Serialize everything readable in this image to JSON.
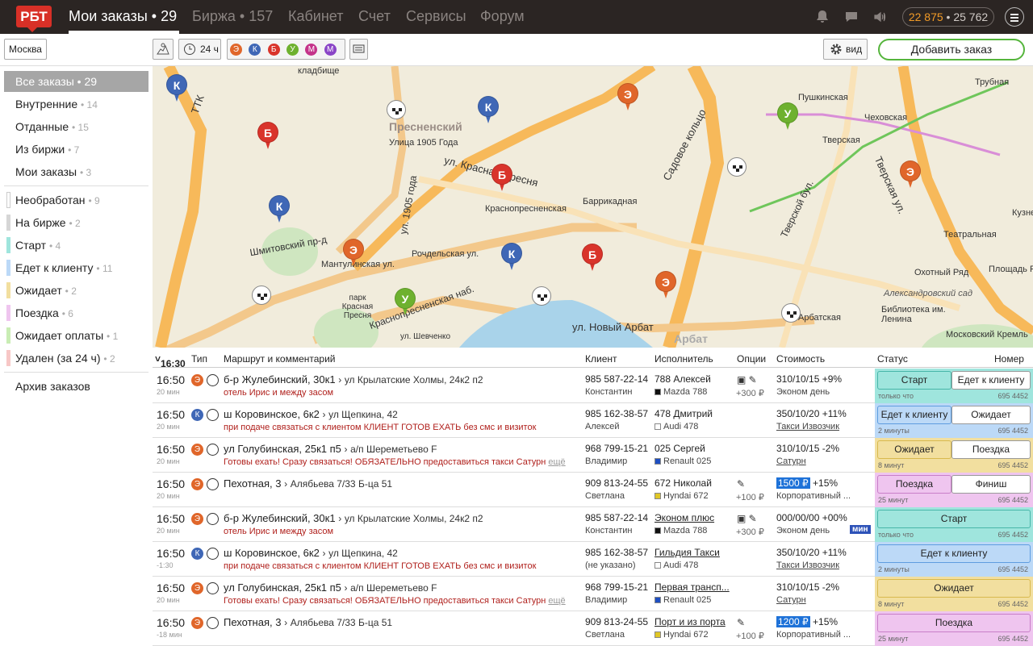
{
  "app": {
    "logo": "РБТ"
  },
  "topnav": [
    {
      "label": "Мои заказы • 29",
      "active": true
    },
    {
      "label": "Биржа • 157"
    },
    {
      "label": "Кабинет"
    },
    {
      "label": "Счет"
    },
    {
      "label": "Сервисы"
    },
    {
      "label": "Форум"
    }
  ],
  "balance": {
    "primary": "22 875",
    "separator": " • ",
    "secondary": "25 762"
  },
  "toolbar": {
    "city": "Москва",
    "period": "24 ч",
    "type_letters": [
      "Э",
      "К",
      "Б",
      "У",
      "М",
      "М"
    ],
    "view_label": "вид",
    "add_order": "Добавить заказ"
  },
  "sidebar": {
    "group1": [
      {
        "label": "Все заказы • 29",
        "count": ""
      },
      {
        "label": "Внутренние",
        "count": "• 14"
      },
      {
        "label": "Отданные",
        "count": "• 15"
      },
      {
        "label": "Из биржи",
        "count": "• 7"
      },
      {
        "label": "Мои заказы",
        "count": "• 3"
      }
    ],
    "group2": [
      {
        "label": "Необработан",
        "count": "• 9",
        "color": "#ffffff"
      },
      {
        "label": "На бирже",
        "count": "• 2",
        "color": "#d6d6d6"
      },
      {
        "label": "Старт",
        "count": "• 4",
        "color": "#9fe5dd"
      },
      {
        "label": "Едет к клиенту",
        "count": "• 11",
        "color": "#bcd9f7"
      },
      {
        "label": "Ожидает",
        "count": "• 2",
        "color": "#f2df9f"
      },
      {
        "label": "Поездка",
        "count": "• 6",
        "color": "#efc5ef"
      },
      {
        "label": "Ожидает оплаты",
        "count": "• 1",
        "color": "#c9edb4"
      },
      {
        "label": "Удален (за 24 ч)",
        "count": "• 2",
        "color": "#f7c7c6"
      }
    ],
    "archive": "Архив заказов"
  },
  "map": {
    "labels": [
      "кладбище",
      "Трубная",
      "Пушкинская",
      "Чеховская",
      "Тверская",
      "Пресненский",
      "Улица 1905 Года",
      "ул. Красная Пресня",
      "Баррикадная",
      "Краснопресненская",
      "Садовое кольцо",
      "Тверской бул.",
      "Тверская ул.",
      "Кузнец",
      "Театральная",
      "Охотный Ряд",
      "Площадь Революции",
      "Александровский сад",
      "Библиотека им. Ленина",
      "Московский Кремль",
      "Арбатская",
      "ул. Новый Арбат",
      "Арбат",
      "Шмитовский пр-д",
      "Мантулинская ул.",
      "Рочдельская ул.",
      "Краснопресненская наб.",
      "парк Красная Пресня",
      "ТТК",
      "ул. 1905 года",
      "ул. Шевченко"
    ]
  },
  "table": {
    "header": {
      "time": "16:30",
      "type": "Тип",
      "route": "Маршрут и комментарий",
      "client": "Клиент",
      "executor": "Исполнитель",
      "options": "Опции",
      "cost": "Стоимость",
      "status": "Статус",
      "number": "Номер"
    },
    "rows": [
      {
        "time": "16:50",
        "ago": "20 мин",
        "type": "Э",
        "from": "б-р Жулебинский, 30к1",
        "to": "ул Крылатские Холмы, 24к2 п2",
        "comment": "отель Ирис и между засом",
        "more": "",
        "phone": "985 587-22-14",
        "client": "Константин",
        "executor": "788 Алексей",
        "car": "Mazda 788",
        "carcolor": "#111111",
        "options": "+300 ₽",
        "price_box": "",
        "price": "310/10/15 +9%",
        "tariff": "Эконом день",
        "status_a": "Старт",
        "status_b": "Едет к клиенту",
        "since": "только что",
        "number": "695 4452",
        "bg": "#9fe5dd",
        "border": "#48b6a9"
      },
      {
        "time": "16:50",
        "ago": "20 мин",
        "type": "К",
        "from": "ш Коровинское, 6к2",
        "to": "ул Щепкина, 42",
        "comment": "при подаче связаться с клиентом КЛИЕНТ ГОТОВ ЕХАТЬ без смс и визиток",
        "more": "",
        "phone": "985 162-38-57",
        "client": "Алексей",
        "executor": "478 Дмитрий",
        "car": "Audi 478",
        "carcolor": "#ffffff",
        "options": "",
        "price_box": "",
        "price": "350/10/20 +11%",
        "tariff": "Такси Извозчик",
        "status_a": "Едет к клиенту",
        "status_b": "Ожидает",
        "since": "2 минуты",
        "number": "695 4452",
        "bg": "#bcd9f7",
        "border": "#5e9de0"
      },
      {
        "time": "16:50",
        "ago": "20 мин",
        "type": "Э",
        "from": "ул Голубинская, 25к1 п5",
        "to": "а/п Шереметьево F",
        "comment": "Готовы ехать! Сразу связаться! ОБЯЗАТЕЛЬНО предоставиться такси Сатурн",
        "more": "ещё",
        "phone": "968 799-15-21",
        "client": "Владимир",
        "executor": "025 Сергей",
        "car": "Renault 025",
        "carcolor": "#1e4fc2",
        "options": "",
        "price_box": "",
        "price": "310/10/15 -2%",
        "tariff": "Сатурн",
        "status_a": "Ожидает",
        "status_b": "Поездка",
        "since": "8 минут",
        "number": "695 4452",
        "bg": "#f2df9f",
        "border": "#d8b94e"
      },
      {
        "time": "16:50",
        "ago": "20 мин",
        "type": "Э",
        "from": "Пехотная, 3",
        "to": "Алябьева 7/33 Б-ца 51",
        "comment": "",
        "more": "",
        "phone": "909 813-24-55",
        "client": "Светлана",
        "executor": "672 Николай",
        "car": "Hyndai 672",
        "carcolor": "#e0c726",
        "options": "+100 ₽",
        "price_box": "1500 ₽",
        "price": "+15%",
        "tariff": "Корпоративный ...",
        "status_a": "Поездка",
        "status_b": "Финиш",
        "since": "25 минут",
        "number": "695 4452",
        "bg": "#efc5ef",
        "border": "#c87ec8"
      },
      {
        "time": "16:50",
        "ago": "20 мин",
        "type": "Э",
        "from": "б-р Жулебинский, 30к1",
        "to": "ул Крылатские Холмы, 24к2 п2",
        "comment": "отель Ирис и между засом",
        "more": "",
        "phone": "985 587-22-14",
        "client": "Константин",
        "executor": "Эконом плюс",
        "car": "Mazda 788",
        "carcolor": "#111111",
        "options": "+300 ₽",
        "price_box": "",
        "price": "000/00/00 +00%",
        "tariff": "Эконом день",
        "status_a": "Старт",
        "status_b": "",
        "since": "только что",
        "number": "695 4452",
        "bg": "#9fe5dd",
        "border": "#48b6a9",
        "link": true,
        "badge": "мин"
      },
      {
        "time": "16:50",
        "ago": "-1:30",
        "type": "К",
        "from": "ш Коровинское, 6к2",
        "to": "ул Щепкина, 42",
        "comment": "при подаче связаться с клиентом КЛИЕНТ ГОТОВ ЕХАТЬ без смс и визиток",
        "more": "",
        "phone": "985 162-38-57",
        "client": "(не указано)",
        "executor": "Гильдия Такси",
        "car": "Audi 478",
        "carcolor": "#ffffff",
        "options": "",
        "price_box": "",
        "price": "350/10/20 +11%",
        "tariff": "Такси Извозчик",
        "status_a": "Едет к клиенту",
        "status_b": "",
        "since": "2 минуты",
        "number": "695 4452",
        "bg": "#bcd9f7",
        "border": "#5e9de0",
        "link": true
      },
      {
        "time": "16:50",
        "ago": "20 мин",
        "type": "Э",
        "from": "ул Голубинская, 25к1 п5",
        "to": "а/п Шереметьево F",
        "comment": "Готовы ехать! Сразу связаться! ОБЯЗАТЕЛЬНО предоставиться такси Сатурн",
        "more": "ещё",
        "phone": "968 799-15-21",
        "client": "Владимир",
        "executor": "Первая трансп...",
        "car": "Renault 025",
        "carcolor": "#1e4fc2",
        "options": "",
        "price_box": "",
        "price": "310/10/15 -2%",
        "tariff": "Сатурн",
        "status_a": "Ожидает",
        "status_b": "",
        "since": "8 минут",
        "number": "695 4452",
        "bg": "#f2df9f",
        "border": "#d8b94e",
        "link": true
      },
      {
        "time": "16:50",
        "ago": "-18 мин",
        "type": "Э",
        "from": "Пехотная, 3",
        "to": "Алябьева 7/33 Б-ца 51",
        "comment": "",
        "more": "",
        "phone": "909 813-24-55",
        "client": "Светлана",
        "executor": "Порт и из порта",
        "car": "Hyndai 672",
        "carcolor": "#e0c726",
        "options": "+100 ₽",
        "price_box": "1200 ₽",
        "price": "+15%",
        "tariff": "Корпоративный ...",
        "status_a": "Поездка",
        "status_b": "",
        "since": "25 минут",
        "number": "695 4452",
        "bg": "#efc5ef",
        "border": "#c87ec8",
        "link": true
      }
    ]
  },
  "colors": {
    "Э": "#e0662a",
    "К": "#3f67b6",
    "Б": "#d9342b",
    "У": "#6eb12f",
    "М1": "#c4338a",
    "М2": "#8a45c7"
  }
}
